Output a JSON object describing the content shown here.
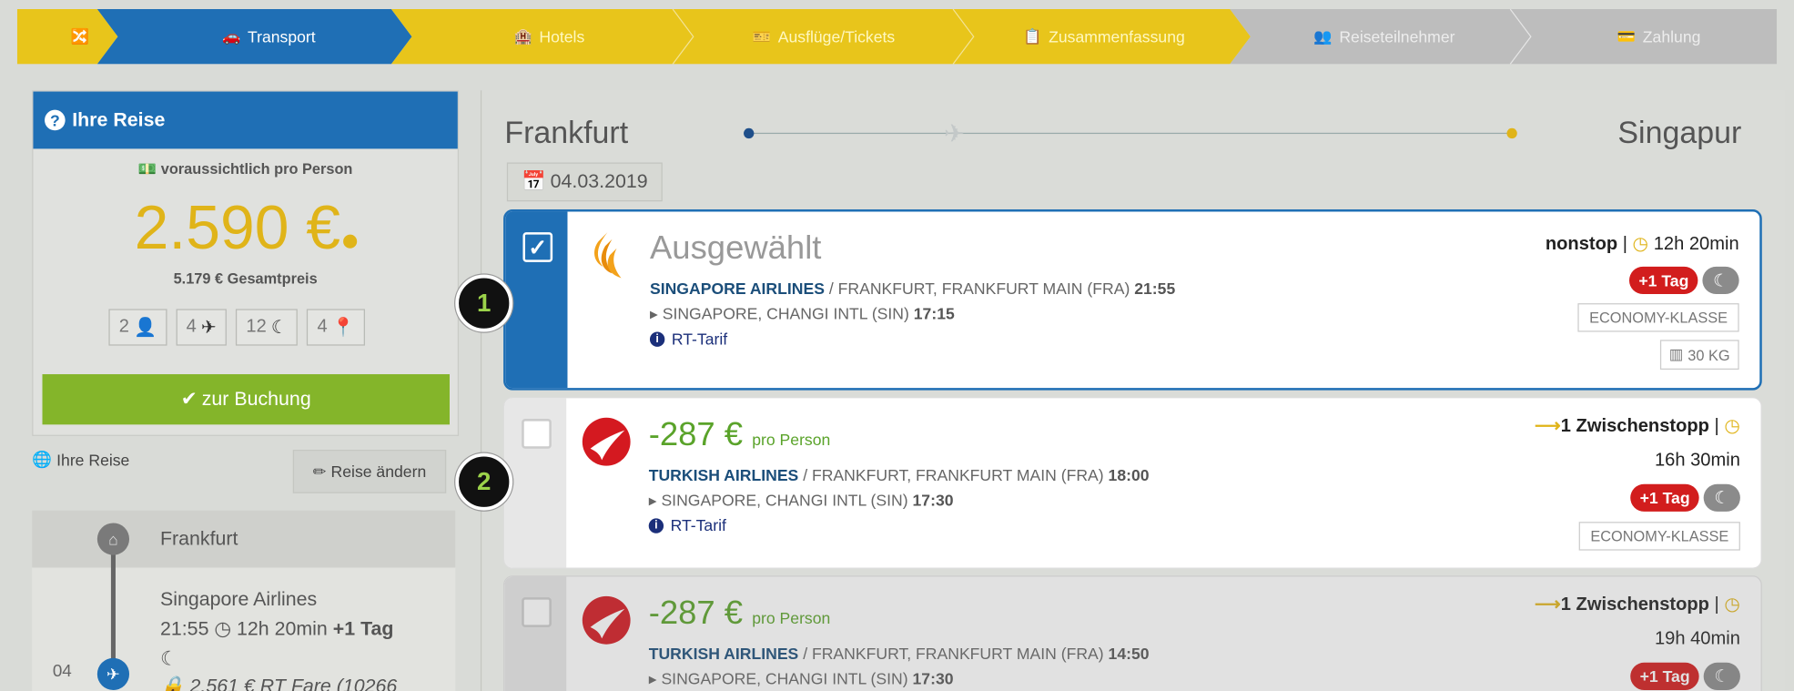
{
  "steps": [
    {
      "label": "",
      "icon": "🔀",
      "state": "done"
    },
    {
      "label": "Transport",
      "icon": "🚗",
      "state": "active"
    },
    {
      "label": "Hotels",
      "icon": "🏨",
      "state": "done"
    },
    {
      "label": "Ausflüge/Tickets",
      "icon": "🎫",
      "state": "done"
    },
    {
      "label": "Zusammenfassung",
      "icon": "📋",
      "state": "done"
    },
    {
      "label": "Reiseteilnehmer",
      "icon": "👥",
      "state": "pending"
    },
    {
      "label": "Zahlung",
      "icon": "💳",
      "state": "pending"
    }
  ],
  "colors": {
    "yellow": "#e8c51b",
    "blue": "#1f6fb5",
    "grey": "#bdbdbd",
    "green": "#84b52a",
    "red": "#d21d1d"
  },
  "sidebar": {
    "title": "Ihre Reise",
    "subtitle": "voraussichtlich pro Person",
    "price": "2.590 €",
    "total": "5.179 € Gesamtpreis",
    "badges": [
      {
        "value": "2",
        "icon": "👤"
      },
      {
        "value": "4",
        "icon": "✈"
      },
      {
        "value": "12",
        "icon": "☾"
      },
      {
        "value": "4",
        "icon": "📍"
      }
    ],
    "book_label": "zur Buchung",
    "section_label": "Ihre Reise",
    "change_label": "Reise ändern"
  },
  "timeline": {
    "city": "Frankfurt",
    "airline": "Singapore Airlines",
    "time_dep": "21:55",
    "duration": "12h 20min",
    "plus_day": "+1 Tag",
    "fare": "2.561 € RT Fare (10266",
    "date": "04"
  },
  "route": {
    "origin": "Frankfurt",
    "destination": "Singapur",
    "date": "04.03.2019"
  },
  "flights": [
    {
      "selected": true,
      "headline": "Ausgewählt",
      "price_unit": "",
      "airline": "SINGAPORE AIRLINES",
      "leg1": " / FRANKFURT, FRANKFURT MAIN (FRA) ",
      "leg1_time": "21:55",
      "leg2": "SINGAPORE, CHANGI INTL (SIN) ",
      "leg2_time": "17:15",
      "tarif": "RT-Tarif",
      "stops": "nonstop",
      "duration": "12h 20min",
      "plus_day": "+1 Tag",
      "cabin": "ECONOMY-KLASSE",
      "baggage": "30 KG"
    },
    {
      "selected": false,
      "headline": "-287 €",
      "price_unit": "pro Person",
      "airline": "TURKISH AIRLINES",
      "leg1": " / FRANKFURT, FRANKFURT MAIN (FRA) ",
      "leg1_time": "18:00",
      "leg2": "SINGAPORE, CHANGI INTL (SIN) ",
      "leg2_time": "17:30",
      "tarif": "RT-Tarif",
      "stops": "1 Zwischenstopp",
      "duration": "16h 30min",
      "plus_day": "+1 Tag",
      "cabin": "ECONOMY-KLASSE"
    },
    {
      "selected": false,
      "headline": "-287 €",
      "price_unit": "pro Person",
      "airline": "TURKISH AIRLINES",
      "leg1": " / FRANKFURT, FRANKFURT MAIN (FRA) ",
      "leg1_time": "14:50",
      "leg2": "SINGAPORE, CHANGI INTL (SIN) ",
      "leg2_time": "17:30",
      "stops": "1 Zwischenstopp",
      "duration": "19h 40min",
      "plus_day": "+1 Tag"
    }
  ],
  "markers": [
    "1",
    "2"
  ]
}
